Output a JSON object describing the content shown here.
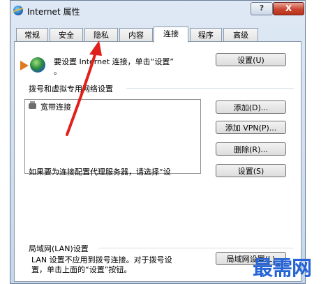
{
  "window": {
    "title": "Internet 属性",
    "help_label": "?",
    "close_label": "X"
  },
  "tabs": [
    {
      "label": "常规"
    },
    {
      "label": "安全"
    },
    {
      "label": "隐私"
    },
    {
      "label": "内容"
    },
    {
      "label": "连接",
      "active": true
    },
    {
      "label": "程序"
    },
    {
      "label": "高级"
    }
  ],
  "setup": {
    "text_line1": "要设置 Internet 连接，单击“设置”",
    "text_line2": "。",
    "button": "设置(U)"
  },
  "dialup": {
    "heading": "拨号和虚拟专用网络设置",
    "connections": [
      "宽带连接"
    ],
    "add_button": "添加(D)...",
    "add_vpn_button": "添加 VPN(P)...",
    "remove_button": "删除(R)...",
    "proxy_text": "如果要为连接配置代理服务器，请选择“设",
    "settings_button": "设置(S)"
  },
  "lan": {
    "heading": "局域网(LAN)设置",
    "text_line1": "LAN 设置不应用到拨号连接。对于拨号设",
    "text_line2": "置，单击上面的“设置”按钮。",
    "button": "局域网设置(L)"
  },
  "watermark": "最需网",
  "colors": {
    "annotation": "#e0201a",
    "watermark": "#2563d6",
    "close": "#c9452f"
  },
  "icons": {
    "app": "ie-globe-icon",
    "setup": "connection-wizard-icon",
    "connection": "broadband-connection-icon"
  }
}
